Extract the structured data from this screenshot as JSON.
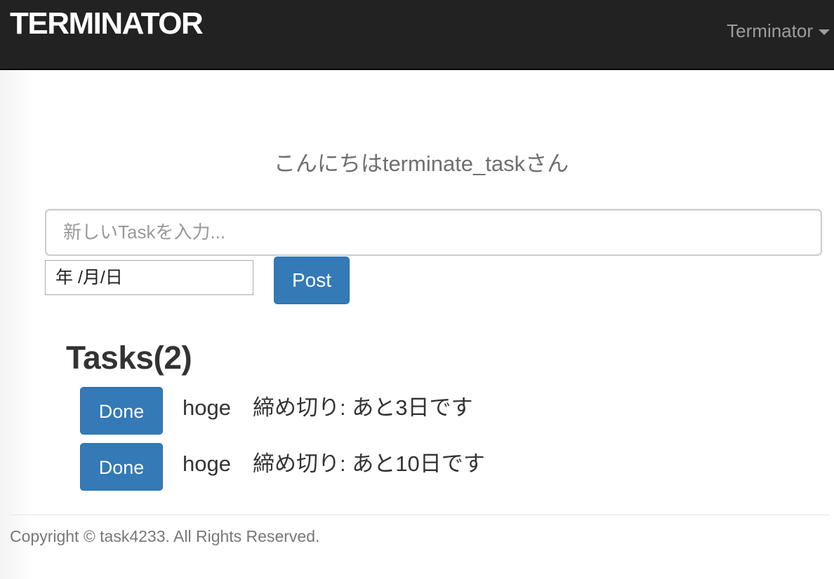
{
  "navbar": {
    "brand": "TERMINATOR",
    "user_menu": "Terminator"
  },
  "greeting": "こんにちはterminate_taskさん",
  "form": {
    "task_placeholder": "新しいTaskを入力...",
    "date_value": "年 /月/日",
    "post_label": "Post"
  },
  "tasks": {
    "heading": "Tasks(2)",
    "items": [
      {
        "done_label": "Done",
        "name": "hoge",
        "deadline": "締め切り: あと3日です"
      },
      {
        "done_label": "Done",
        "name": "hoge",
        "deadline": "締め切り: あと10日です"
      }
    ]
  },
  "footer": {
    "copyright": "Copyright © task4233. All Rights Reserved."
  },
  "colors": {
    "navbar_bg": "#222222",
    "primary": "#337ab7",
    "muted_text": "#9d9d9d"
  }
}
